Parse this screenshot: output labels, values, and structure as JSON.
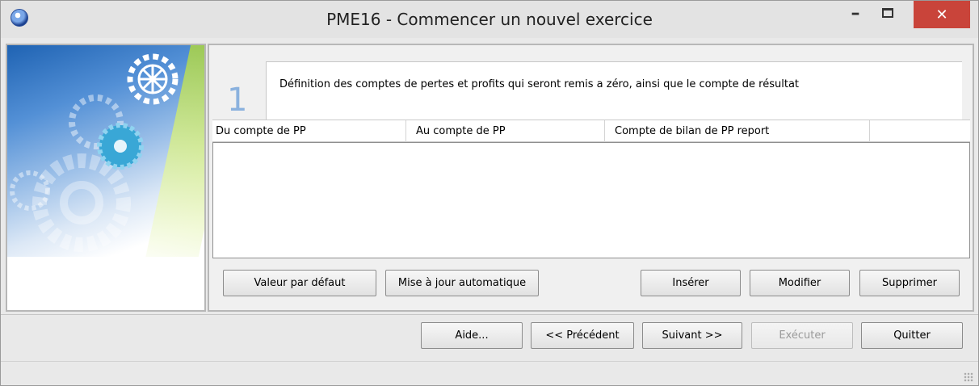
{
  "window": {
    "title": "PME16 - Commencer un nouvel exercice",
    "controls": {
      "minimize": "–",
      "close": "✕"
    }
  },
  "step": {
    "number": "1",
    "description": "Définition des comptes de pertes et profits qui seront remis a zéro, ainsi que le compte de résultat"
  },
  "grid": {
    "columns": [
      "Du compte de PP",
      "Au compte de PP",
      "Compte de bilan de PP report",
      ""
    ],
    "rows": []
  },
  "grid_buttons": {
    "default_value": "Valeur par défaut",
    "auto_update": "Mise à jour automatique",
    "insert": "Insérer",
    "modify": "Modifier",
    "delete": "Supprimer"
  },
  "wizard_buttons": {
    "help": "Aide...",
    "previous": "<< Précédent",
    "next": "Suivant >>",
    "execute": "Exécuter",
    "quit": "Quitter"
  },
  "icons": {
    "app": "app-globe-icon",
    "minimize": "minimize-icon",
    "maximize": "maximize-icon",
    "close": "close-icon",
    "resize": "resize-grip-icon"
  },
  "colors": {
    "close_button": "#c9443a",
    "step_number": "#8ab1de"
  }
}
